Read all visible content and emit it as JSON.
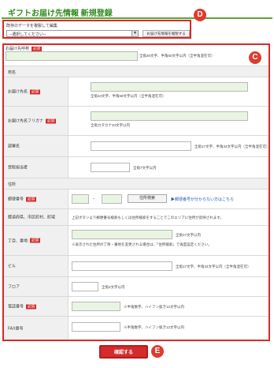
{
  "page": {
    "title": "ギフトお届け先情報 新規登録"
  },
  "duplicate": {
    "label": "既存のデータを複製して編集",
    "select_value": "--選択してください--",
    "button_label": "お届け先情報を複製する"
  },
  "markers": {
    "d": "D",
    "c": "C",
    "e": "E"
  },
  "form": {
    "recipient_id": {
      "label": "お届け先呼称",
      "required": "必須",
      "hint": "全角30文字、半角60文字以内（全半角混在可）"
    },
    "addressee_section": "宛名",
    "name": {
      "label": "お届け先名",
      "required": "必須",
      "hint": "全角34文字、半角68文字以内（全半角混在可）"
    },
    "furigana": {
      "label": "お届け先名フリガナ",
      "required": "必須",
      "hint": "全角カタカナ34文字以内"
    },
    "department": {
      "label": "部署名",
      "hint": "全角17文字、半角34文字以内（全半角混在可）"
    },
    "recipient_person": {
      "label": "受取担当者",
      "hint": "全角7文字以内"
    },
    "address_section": "住所",
    "postal": {
      "label": "郵便番号",
      "required": "必須",
      "separator": "-",
      "search_button": "住所検索",
      "link_text": "郵便番号が分からない方はこちら"
    },
    "prefecture": {
      "label": "都道府県、市区町村、町域",
      "hint": "上記ボタンより郵便番号検索もしくは住所検索をすることでこのエリアに住所が反映されます。"
    },
    "chome": {
      "label": "丁目、番地",
      "required": "必須",
      "hint": "全角17文字以内",
      "note": "※表示された住所の丁目・番地を変更される場合は、「住所検索」で再度設定ください。"
    },
    "building": {
      "label": "ビル",
      "hint": "全角17文字、半角34文字以内（全半角混在可）"
    },
    "floor": {
      "label": "フロア",
      "hint": "全角4文字以内"
    },
    "phone": {
      "label": "電話番号",
      "required": "必須",
      "hint": "※半角数字、ハイフン抜き12文字以内"
    },
    "fax": {
      "label": "FAX番号",
      "hint": "※半角数字、ハイフン抜き12文字以内"
    }
  },
  "confirm_button": "確認する"
}
